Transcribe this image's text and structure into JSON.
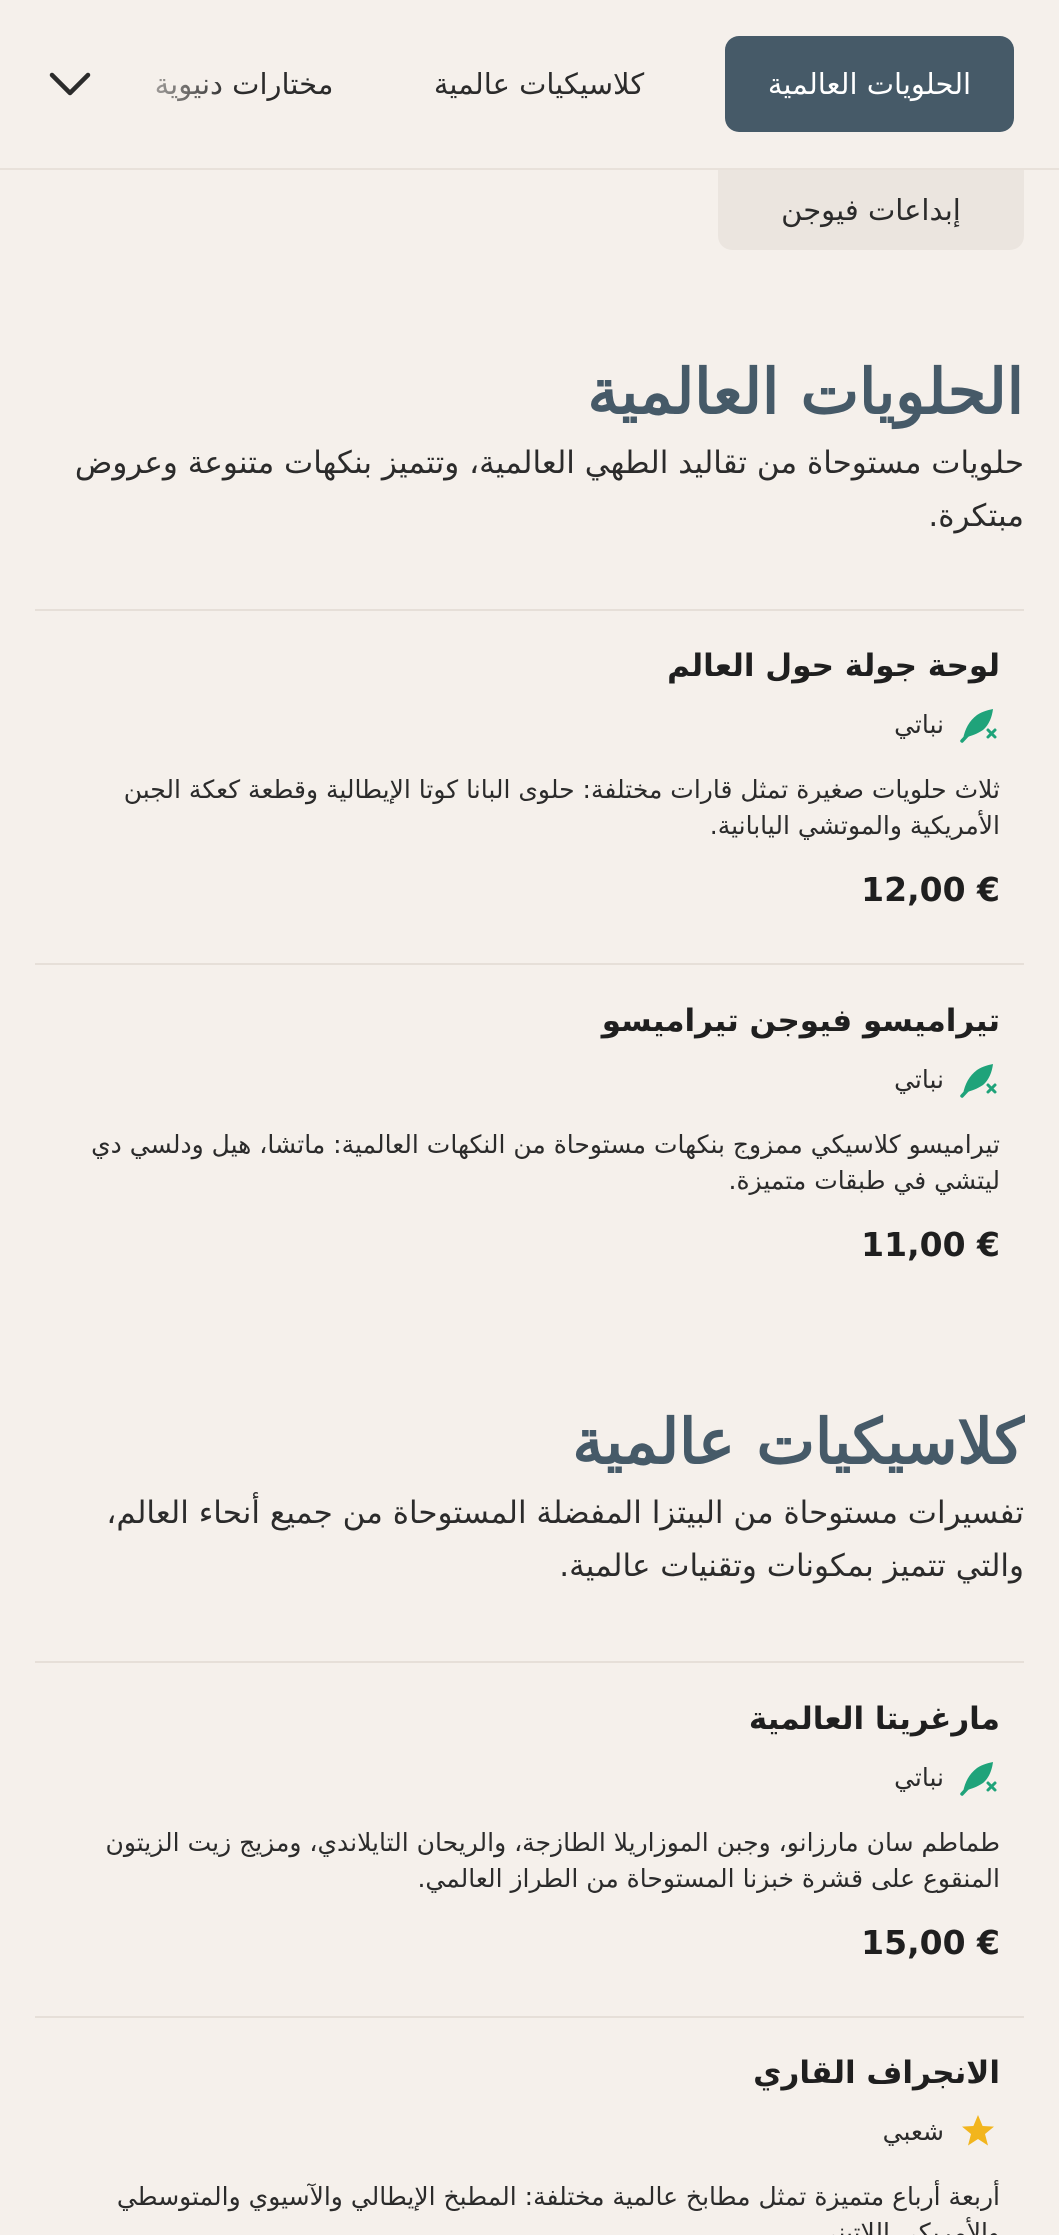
{
  "nav": {
    "tabs": [
      {
        "label": "الحلويات العالمية",
        "active": true
      },
      {
        "label": "كلاسيكيات عالمية",
        "active": false
      },
      {
        "label": "مختارات دنيوية",
        "active": false
      }
    ],
    "overflow_tab": "إبداعات فيوجن",
    "expand_icon": "chevron-down-icon"
  },
  "sections": [
    {
      "title": "الحلويات العالمية",
      "description": "حلويات مستوحاة من تقاليد الطهي العالمية، وتتميز بنكهات متنوعة وعروض مبتكرة.",
      "items": [
        {
          "name": "لوحة جولة حول العالم",
          "badge": "نباتي",
          "badge_icon": "vegetarian-leaf-icon",
          "description": "ثلاث حلويات صغيرة تمثل قارات مختلفة: حلوى البانا كوتا الإيطالية وقطعة كعكة الجبن الأمريكية والموتشي اليابانية.",
          "price": "12,00 €"
        },
        {
          "name": "تيراميسو فيوجن تيراميسو",
          "badge": "نباتي",
          "badge_icon": "vegetarian-leaf-icon",
          "description": "تيراميسو كلاسيكي ممزوج بنكهات مستوحاة من النكهات العالمية: ماتشا، هيل ودلسي دي ليتشي في طبقات متميزة.",
          "price": "11,00 €"
        }
      ]
    },
    {
      "title": "كلاسيكيات عالمية",
      "description": "تفسيرات مستوحاة من البيتزا المفضلة المستوحاة من جميع أنحاء العالم، والتي تتميز بمكونات وتقنيات عالمية.",
      "items": [
        {
          "name": "مارغريتا العالمية",
          "badge": "نباتي",
          "badge_icon": "vegetarian-leaf-icon",
          "description": "طماطم سان مارزانو، وجبن الموزاريلا الطازجة، والريحان التايلاندي، ومزيج زيت الزيتون المنقوع على قشرة خبزنا المستوحاة من الطراز العالمي.",
          "price": "15,00 €"
        },
        {
          "name": "الانجراف القاري",
          "badge": "شعبي",
          "badge_icon": "star-icon",
          "description": "أربعة أرباع متميزة تمثل مطابخ عالمية مختلفة: المطبخ الإيطالي والآسيوي والمتوسطي والأمريكي اللاتيني.",
          "price": ""
        }
      ]
    }
  ],
  "colors": {
    "background": "#f5f0eb",
    "accent": "#465a68",
    "veg_green": "#1fa37a",
    "star_gold": "#f2b51d"
  }
}
